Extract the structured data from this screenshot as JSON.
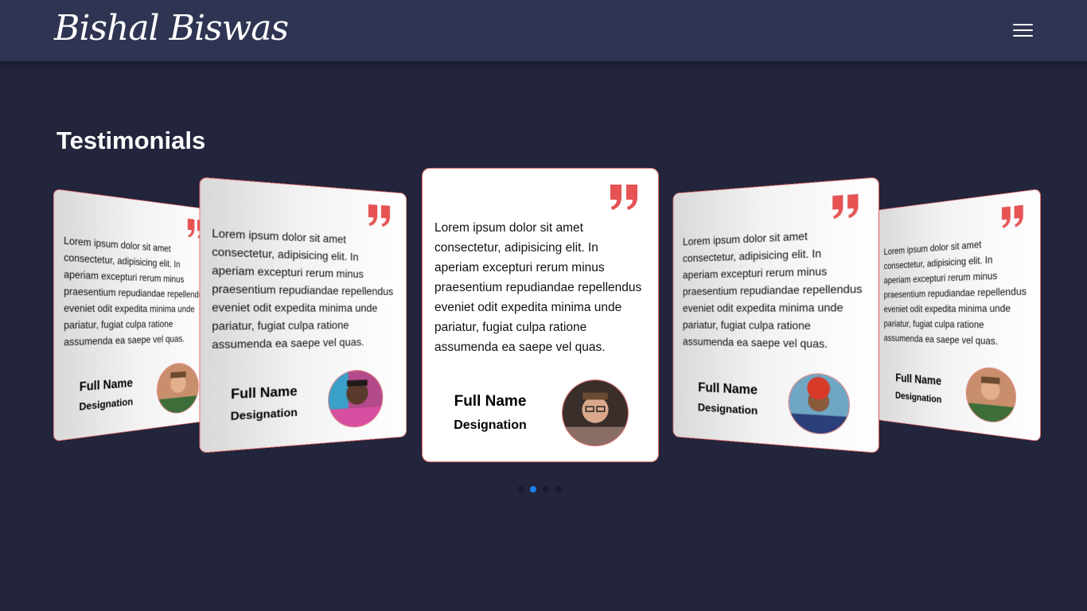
{
  "header": {
    "logo_text": "Bishal Biswas",
    "menu_icon": "hamburger-menu-icon"
  },
  "section": {
    "title": "Testimonials"
  },
  "testimonials": [
    {
      "text": "Lorem ipsum dolor sit amet consectetur, adipisicing elit. In aperiam excepturi rerum minus praesentium repudiandae repellendus eveniet odit expedita minima unde pariatur, fugiat culpa ratione assumenda ea saepe vel quas.",
      "name": "Full Name",
      "designation": "Designation",
      "avatar": "avatar-man-green-shirt"
    },
    {
      "text": "Lorem ipsum dolor sit amet consectetur, adipisicing elit. In aperiam excepturi rerum minus praesentium repudiandae repellendus eveniet odit expedita minima unde pariatur, fugiat culpa ratione assumenda ea saepe vel quas.",
      "name": "Full Name",
      "designation": "Designation",
      "avatar": "avatar-man-colorful-background"
    },
    {
      "text": "Lorem ipsum dolor sit amet consectetur, adipisicing elit. In aperiam excepturi rerum minus praesentium repudiandae repellendus eveniet odit expedita minima unde pariatur, fugiat culpa ratione assumenda ea saepe vel quas.",
      "name": "Full Name",
      "designation": "Designation",
      "avatar": "avatar-man-glasses"
    },
    {
      "text": "Lorem ipsum dolor sit amet consectetur, adipisicing elit. In aperiam excepturi rerum minus praesentium repudiandae repellendus eveniet odit expedita minima unde pariatur, fugiat culpa ratione assumenda ea saepe vel quas.",
      "name": "Full Name",
      "designation": "Designation",
      "avatar": "avatar-woman-red-hair"
    },
    {
      "text": "Lorem ipsum dolor sit amet consectetur, adipisicing elit. In aperiam excepturi rerum minus praesentium repudiandae repellendus eveniet odit expedita minima unde pariatur, fugiat culpa ratione assumenda ea saepe vel quas.",
      "name": "Full Name",
      "designation": "Designation",
      "avatar": "avatar-man-green-shirt"
    }
  ],
  "pagination": {
    "count": 4,
    "active_index": 1
  },
  "colors": {
    "page_background": "#22253b",
    "navbar_background": "#2f3452",
    "accent_quote": "#e55353",
    "card_border": "#e36b6b",
    "dot_active": "#1e7ef0",
    "dot_inactive": "#1a1c2c"
  }
}
